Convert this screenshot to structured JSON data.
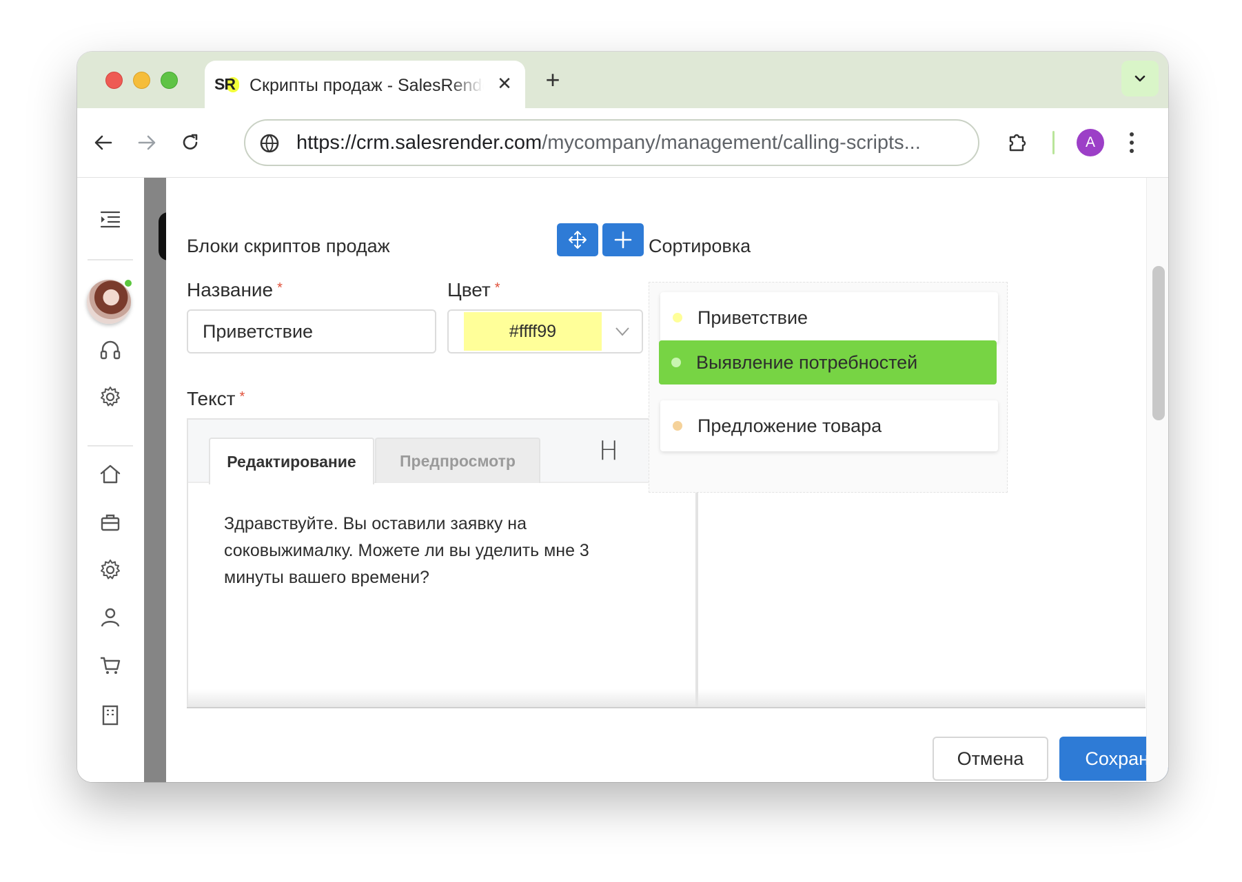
{
  "browser": {
    "tab_title": "Скрипты продаж - SalesRender",
    "tab_favicon": "SR",
    "url_host": "https://crm.salesrender.com",
    "url_path": "/mycompany/management/calling-scripts...",
    "profile_initial": "A"
  },
  "modal": {
    "title": "Блоки скриптов продаж",
    "sort_title": "Сортировка",
    "name_label": "Название",
    "color_label": "Цвет",
    "text_label": "Текст",
    "required_mark": "*",
    "name_value": "Приветствие",
    "color_value": "#ffff99",
    "editor_tab_edit": "Редактирование",
    "editor_tab_preview": "Предпросмотр",
    "editor_heading_btn": "H",
    "editor_text": "Здравствуйте. Вы оставили заявку на соковыжималку. Можете ли вы уделить мне 3 минуты вашего времени?",
    "cancel_label": "Отмена",
    "save_label": "Сохранить"
  },
  "sort_items": [
    {
      "label": "Приветствие",
      "color": "#ffff99",
      "active": false
    },
    {
      "label": "Выявление потребностей",
      "color": "#77d444",
      "active": true
    },
    {
      "label": "Предложение товара",
      "color": "#f5d29a",
      "active": false
    }
  ],
  "colors": {
    "accent": "#2e7bd6",
    "danger": "#d9534f",
    "active_item": "#77d444",
    "swatch": "#ffff99"
  }
}
